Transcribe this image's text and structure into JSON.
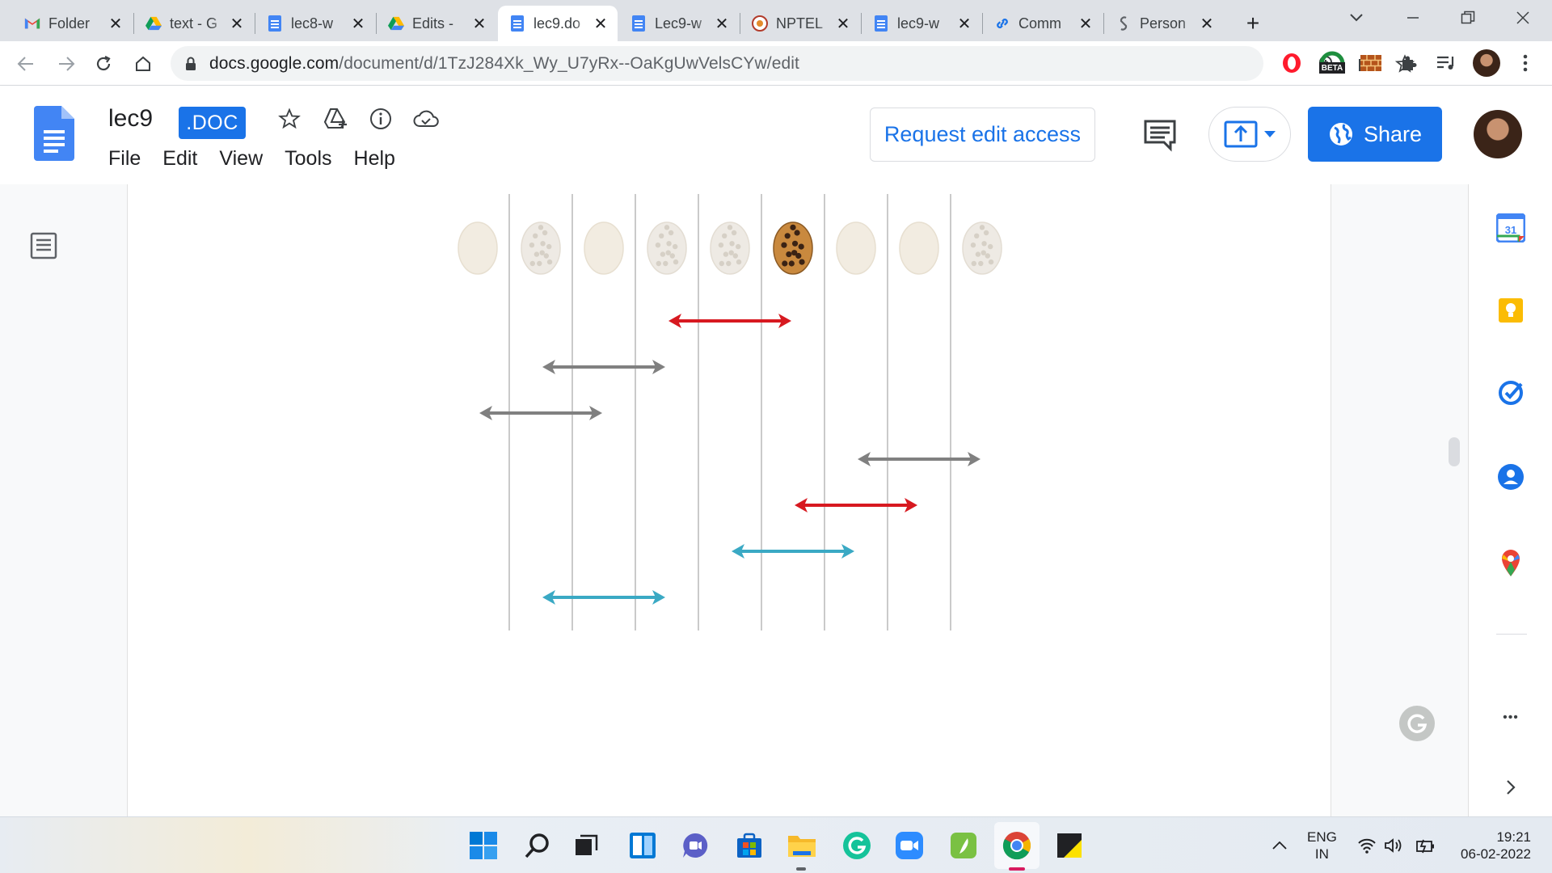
{
  "browser": {
    "tabs": [
      {
        "title": "Folder",
        "icon": "gmail-icon",
        "active": false
      },
      {
        "title": "text - G",
        "icon": "google-drive-icon",
        "active": false
      },
      {
        "title": "lec8-w",
        "icon": "google-docs-icon",
        "active": false
      },
      {
        "title": "Edits -",
        "icon": "google-drive-icon",
        "active": false
      },
      {
        "title": "lec9.do",
        "icon": "google-docs-icon",
        "active": true
      },
      {
        "title": "Lec9-w",
        "icon": "google-docs-icon",
        "active": false
      },
      {
        "title": "NPTEL",
        "icon": "nptel-icon",
        "active": false
      },
      {
        "title": "lec9-w",
        "icon": "google-docs-icon",
        "active": false
      },
      {
        "title": "Comm",
        "icon": "link-icon",
        "active": false
      },
      {
        "title": "Person",
        "icon": "person-link-icon",
        "active": false
      }
    ],
    "close_glyph": "✕",
    "new_tab_glyph": "+",
    "url_host": "docs.google.com",
    "url_path": "/document/d/1TzJ284Xk_Wy_U7yRx--OaKgUwVelsCYw/edit",
    "beta_badge": "BETA"
  },
  "docs": {
    "title": "lec9",
    "format_badge": ".DOC",
    "menu": [
      "File",
      "Edit",
      "View",
      "Tools",
      "Help"
    ],
    "request_edit_label": "Request edit access",
    "share_label": "Share"
  },
  "diagram": {
    "cookies": [
      "plain",
      "chip",
      "plain",
      "chip",
      "chip",
      "choc",
      "plain",
      "plain",
      "chip"
    ],
    "cookie_style": {
      "plain": {
        "fill": "#f2ece1",
        "edge": "#e7dfd0",
        "dot": "#f2ece1"
      },
      "chip": {
        "fill": "#eeeae4",
        "edge": "#e3ddd3",
        "dot": "#d6d0c6"
      },
      "choc": {
        "fill": "#c9893e",
        "edge": "#8b5a24",
        "dot": "#3b2314"
      }
    },
    "intervals": [
      {
        "from": 3,
        "to": 5,
        "color": "red"
      },
      {
        "from": 1,
        "to": 3,
        "color": "gray"
      },
      {
        "from": 0,
        "to": 2,
        "color": "gray"
      },
      {
        "from": 6,
        "to": 8,
        "color": "gray"
      },
      {
        "from": 5,
        "to": 7,
        "color": "red"
      },
      {
        "from": 4,
        "to": 6,
        "color": "teal"
      },
      {
        "from": 1,
        "to": 3,
        "color": "teal"
      }
    ],
    "colors": {
      "red": "#d71920",
      "gray": "#808080",
      "teal": "#3aa9c4",
      "line": "#b8b8b8"
    }
  },
  "side_panel": {
    "icons": [
      "google-calendar-icon",
      "google-keep-icon",
      "google-tasks-icon",
      "google-contacts-icon",
      "google-maps-icon"
    ],
    "calendar_day": "31",
    "more_glyph": "•••"
  },
  "taskbar": {
    "apps": [
      "windows-start-icon",
      "search-icon",
      "task-view-icon",
      "widgets-icon",
      "teams-chat-icon",
      "microsoft-store-icon",
      "file-explorer-icon",
      "grammarly-icon",
      "zoom-icon",
      "evernote-icon",
      "chrome-icon",
      "sticky-notes-icon"
    ],
    "lang_primary": "ENG",
    "lang_secondary": "IN",
    "time": "19:21",
    "date": "06-02-2022"
  },
  "theme": {
    "accent": "#1a73e8",
    "docs_blue": "#4285f4"
  }
}
